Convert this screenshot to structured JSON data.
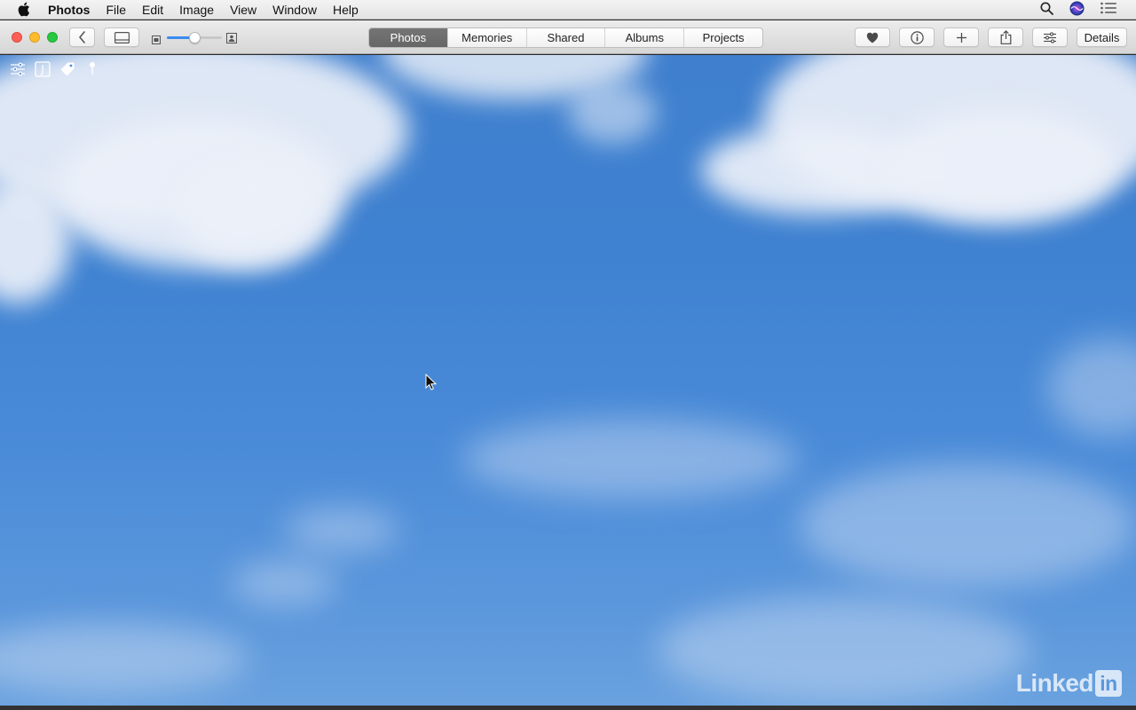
{
  "menubar": {
    "apple_icon": "apple-logo-icon",
    "app_name": "Photos",
    "items": [
      "File",
      "Edit",
      "Image",
      "View",
      "Window",
      "Help"
    ],
    "right_icons": [
      "spotlight-search-icon",
      "siri-icon",
      "notification-center-icon"
    ]
  },
  "toolbar": {
    "window_controls": [
      "close",
      "minimize",
      "zoom"
    ],
    "back_icon": "chevron-left-icon",
    "sidebar_icon": "sidebar-toggle-icon",
    "zoom_slider": {
      "level": 0.5,
      "min_icon": "small-photo-icon",
      "max_icon": "large-photo-icon"
    },
    "tabs": [
      {
        "label": "Photos",
        "active": true
      },
      {
        "label": "Memories",
        "active": false
      },
      {
        "label": "Shared",
        "active": false
      },
      {
        "label": "Albums",
        "active": false
      },
      {
        "label": "Projects",
        "active": false
      }
    ],
    "actions": [
      "heart-icon",
      "info-icon",
      "add-icon",
      "share-icon",
      "adjust-icon"
    ],
    "details_label": "Details"
  },
  "photo": {
    "edit_tools": [
      "adjustments-icon",
      "keyword-icon",
      "tag-icon",
      "location-pin-icon"
    ],
    "keyword_letter": "J",
    "colors": {
      "sky_top": "#3f7fce",
      "sky_bottom": "#6aa2df",
      "cloud": "#ebf0f8"
    }
  },
  "watermark": {
    "text": "Linked",
    "badge": "in"
  }
}
